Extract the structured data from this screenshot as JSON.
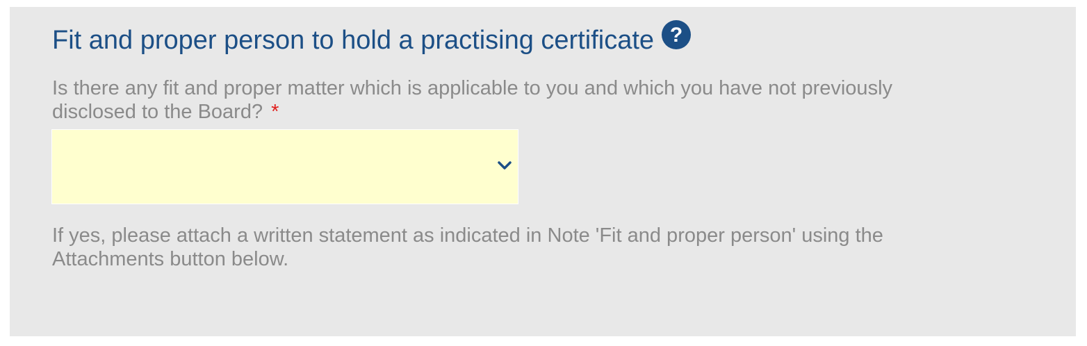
{
  "section": {
    "title": "Fit and proper person to hold a practising certificate",
    "help_icon": "question-circle-icon"
  },
  "question": {
    "text": "Is there any fit and proper matter which is applicable to you and which you have not previously disclosed to the Board?",
    "required_mark": "*"
  },
  "select": {
    "value": "",
    "icon": "chevron-down-icon"
  },
  "note": {
    "text": "If yes, please attach a written statement as indicated in Note 'Fit and proper person' using the Attachments button below."
  },
  "colors": {
    "title": "#1c4f86",
    "panel_bg": "#e8e8e8",
    "field_bg": "#ffffcf",
    "required": "#e0201e",
    "body_text": "#8a8a8a"
  }
}
